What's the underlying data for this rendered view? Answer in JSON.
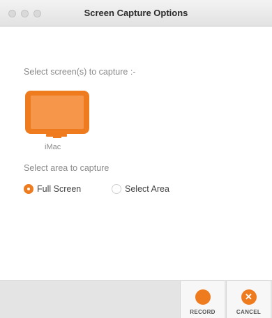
{
  "window": {
    "title": "Screen Capture Options"
  },
  "screens": {
    "prompt": "Select screen(s) to capture :-",
    "devices": [
      {
        "name": "iMac"
      }
    ]
  },
  "area": {
    "prompt": "Select area to capture",
    "options": [
      {
        "label": "Full Screen",
        "selected": true
      },
      {
        "label": "Select Area",
        "selected": false
      }
    ]
  },
  "footer": {
    "record_label": "RECORD",
    "cancel_label": "CANCEL"
  },
  "colors": {
    "accent": "#ef7b1f"
  },
  "icons": {
    "monitor": "monitor-icon",
    "record": "record-icon",
    "cancel": "close-icon"
  }
}
